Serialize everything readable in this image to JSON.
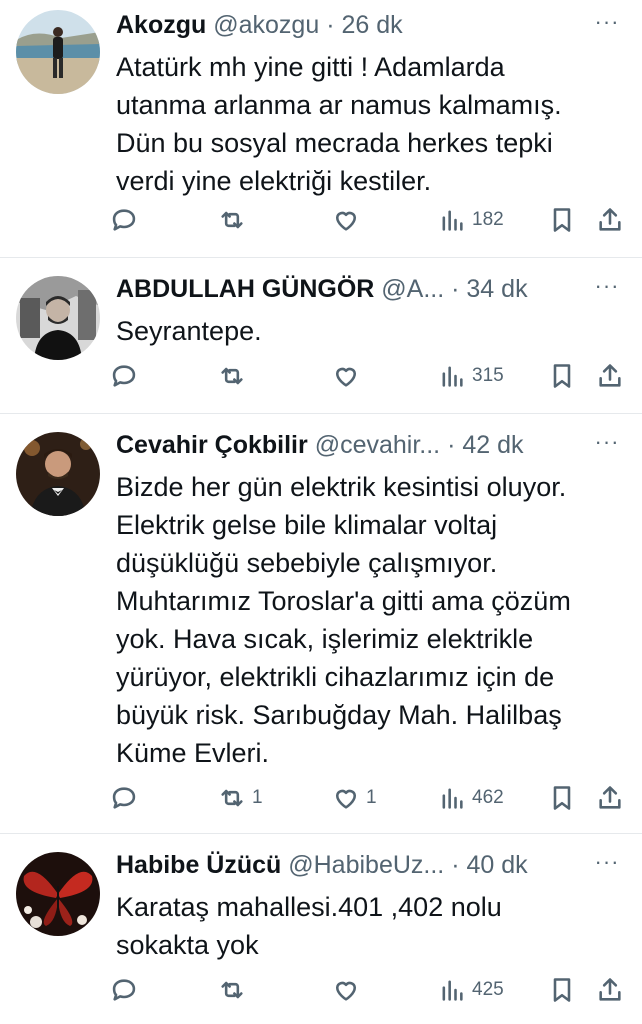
{
  "tweets": [
    {
      "name": "Akozgu",
      "handle": "@akozgu",
      "time": "26 dk",
      "text": "Atatürk mh yine gitti ! Adamlarda\nutanma arlanma ar namus kalmamış.\nDün bu sosyal mecrada herkes tepki\nverdi yine elektriği kestiler.",
      "replies": "",
      "retweets": "",
      "likes": "",
      "views": "182"
    },
    {
      "name": "ABDULLAH GÜNGÖR",
      "handle": "@A...",
      "time": "34 dk",
      "text": "Seyrantepe.",
      "replies": "",
      "retweets": "",
      "likes": "",
      "views": "315"
    },
    {
      "name": "Cevahir Çokbilir",
      "handle": "@cevahir...",
      "time": "42 dk",
      "text": "Bizde her gün elektrik kesintisi oluyor.\nElektrik gelse bile klimalar voltaj\ndüşüklüğü sebebiyle çalışmıyor.\nMuhtarımız Toroslar'a gitti ama çözüm\nyok. Hava sıcak, işlerimiz elektrikle\nyürüyor, elektrikli cihazlarımız için de\nbüyük risk. Sarıbuğday Mah. Halilbaş\nKüme Evleri.",
      "replies": "",
      "retweets": "1",
      "likes": "1",
      "views": "462"
    },
    {
      "name": "Habibe Üzücü",
      "handle": "@HabibeUz...",
      "time": "40 dk",
      "text": "Karataş mahallesi.401 ,402 nolu\nsokakta yok",
      "replies": "",
      "retweets": "",
      "likes": "",
      "views": "425"
    }
  ],
  "separator": "·",
  "more_glyph": "···"
}
